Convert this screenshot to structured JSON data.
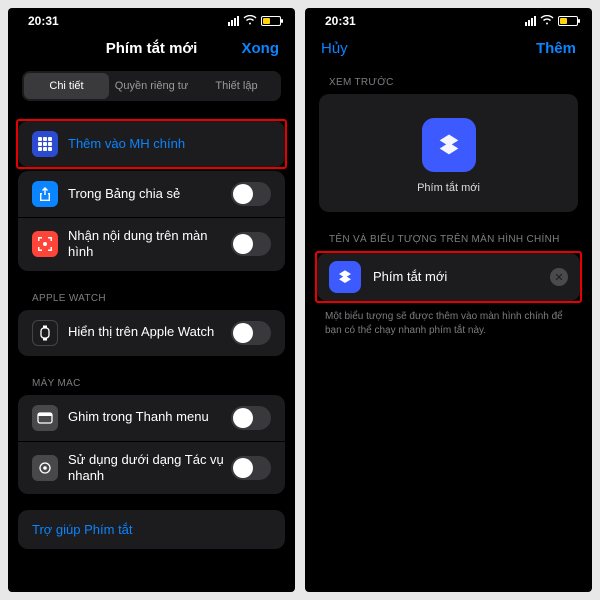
{
  "status": {
    "time": "20:31"
  },
  "left": {
    "title": "Phím tắt mới",
    "done": "Xong",
    "seg": {
      "a": "Chi tiết",
      "b": "Quyền riêng tư",
      "c": "Thiết lập"
    },
    "rows": {
      "addHome": "Thêm vào MH chính",
      "share": "Trong Bảng chia sẻ",
      "receive": "Nhận nội dung trên màn hình",
      "watchHeader": "APPLE WATCH",
      "watch": "Hiển thị trên Apple Watch",
      "macHeader": "MÁY MAC",
      "pin": "Ghim trong Thanh menu",
      "quick": "Sử dụng dưới dạng Tác vụ nhanh",
      "help": "Trợ giúp Phím tắt"
    }
  },
  "right": {
    "cancel": "Hủy",
    "add": "Thêm",
    "previewHeader": "XEM TRƯỚC",
    "previewLabel": "Phím tắt mới",
    "nameHeader": "TÊN VÀ BIỂU TƯỢNG TRÊN MÀN HÌNH CHÍNH",
    "nameValue": "Phím tắt mới",
    "desc": "Một biểu tượng sẽ được thêm vào màn hình chính để bạn có thể chạy nhanh phím tắt này."
  }
}
